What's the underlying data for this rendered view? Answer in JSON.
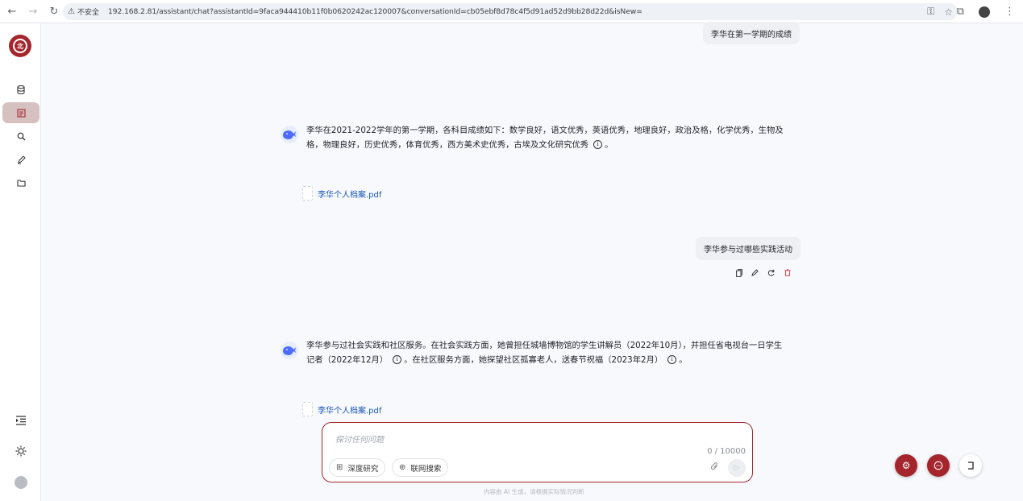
{
  "browser": {
    "insecure_label": "不安全",
    "url": "192.168.2.81/assistant/chat?assistantId=9faca944410b11f0b0620242ac120007&conversationId=cb05ebf8d78c4f5d91ad52d9bb28d22d&isNew="
  },
  "sidebar": {
    "items": [
      {
        "icon": "database-icon"
      },
      {
        "icon": "document-icon"
      },
      {
        "icon": "search-icon"
      },
      {
        "icon": "edit-link-icon"
      },
      {
        "icon": "folder-icon"
      }
    ]
  },
  "chat": {
    "messages": [
      {
        "role": "user",
        "text": "李华在第一学期的成绩"
      },
      {
        "role": "assistant",
        "text": "李华在2021-2022学年的第一学期，各科目成绩如下：数学良好，语文优秀，英语优秀，地理良好，政治及格，化学优秀，生物及格，物理良好，历史优秀，体育优秀，西方美术史优秀，古埃及文化研究优秀",
        "end": "。",
        "file": "李华个人档案.pdf"
      },
      {
        "role": "user",
        "text": "李华参与过哪些实践活动"
      },
      {
        "role": "assistant",
        "text1": "李华参与过社会实践和社区服务。在社会实践方面，她曾担任城墙博物馆的学生讲解员（2022年10月），并担任省电视台一日学生记者（2022年12月）",
        "text2": "。在社区服务方面，她探望社区孤寡老人，送春节祝福（2023年2月）",
        "end": "。",
        "file": "李华个人档案.pdf"
      }
    ]
  },
  "composer": {
    "placeholder": "探讨任何问题",
    "counter": "0 / 10000",
    "deep_research": "深度研究",
    "web_search": "联网搜索"
  },
  "disclaimer": "内容由 AI 生成，请根据实际情况判断"
}
